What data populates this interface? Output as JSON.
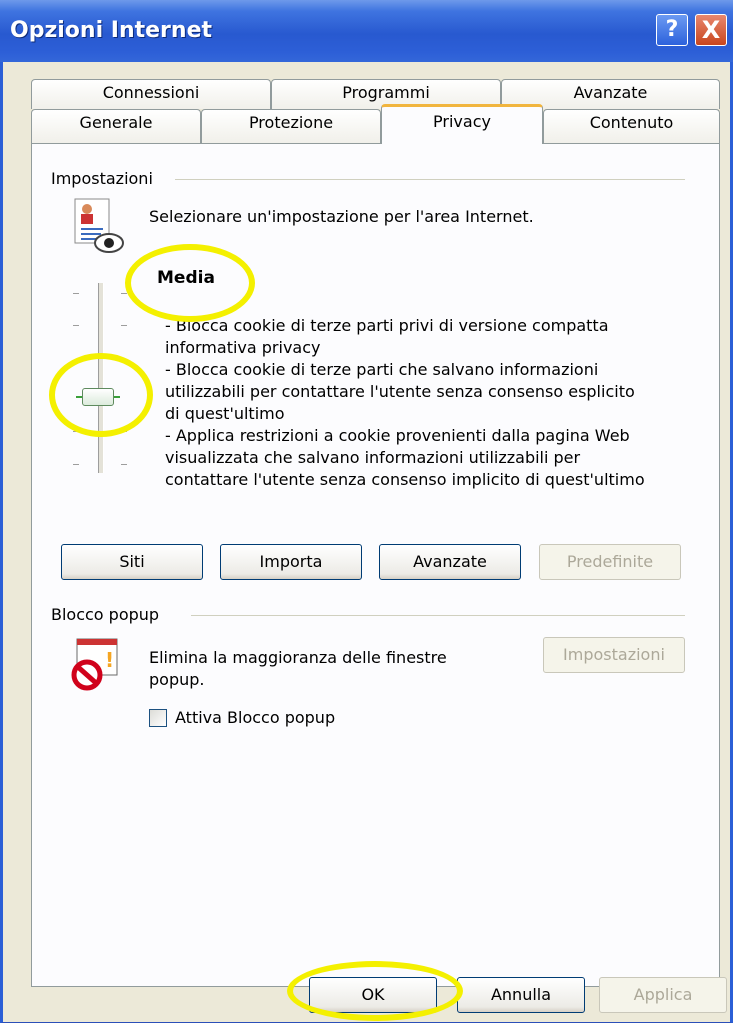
{
  "window": {
    "title": "Opzioni Internet",
    "help_button": "?",
    "close_button": "X"
  },
  "tabs": {
    "back_row": [
      "Connessioni",
      "Programmi",
      "Avanzate"
    ],
    "front_row": [
      "Generale",
      "Protezione",
      "Privacy",
      "Contenuto"
    ],
    "active": "Privacy"
  },
  "privacy": {
    "settings_group": "Impostazioni",
    "instruction": "Selezionare un'impostazione per l'area Internet.",
    "level": "Media",
    "description_lines": [
      "- Blocca cookie di terze parti privi di versione compatta",
      "informativa privacy",
      "- Blocca cookie di terze parti che salvano informazioni",
      "utilizzabili per contattare l'utente senza consenso esplicito",
      "di quest'ultimo",
      "- Applica restrizioni a cookie provenienti dalla pagina Web",
      "visualizzata che salvano informazioni utilizzabili per",
      "contattare l'utente senza consenso implicito di quest'ultimo"
    ],
    "buttons": {
      "sites": "Siti",
      "import": "Importa",
      "advanced": "Avanzate",
      "default": "Predefinite"
    },
    "slider_level_index": 2
  },
  "popup": {
    "group": "Blocco popup",
    "description_line1": "Elimina la maggioranza delle finestre",
    "description_line2": "popup.",
    "settings_button": "Impostazioni",
    "checkbox_label": "Attiva Blocco popup",
    "checkbox_checked": false
  },
  "footer": {
    "ok": "OK",
    "cancel": "Annulla",
    "apply": "Applica"
  },
  "colors": {
    "titlebar": "#2859d0",
    "highlight_circle": "#f4f000",
    "active_tab_accent": "#f1b53e"
  }
}
